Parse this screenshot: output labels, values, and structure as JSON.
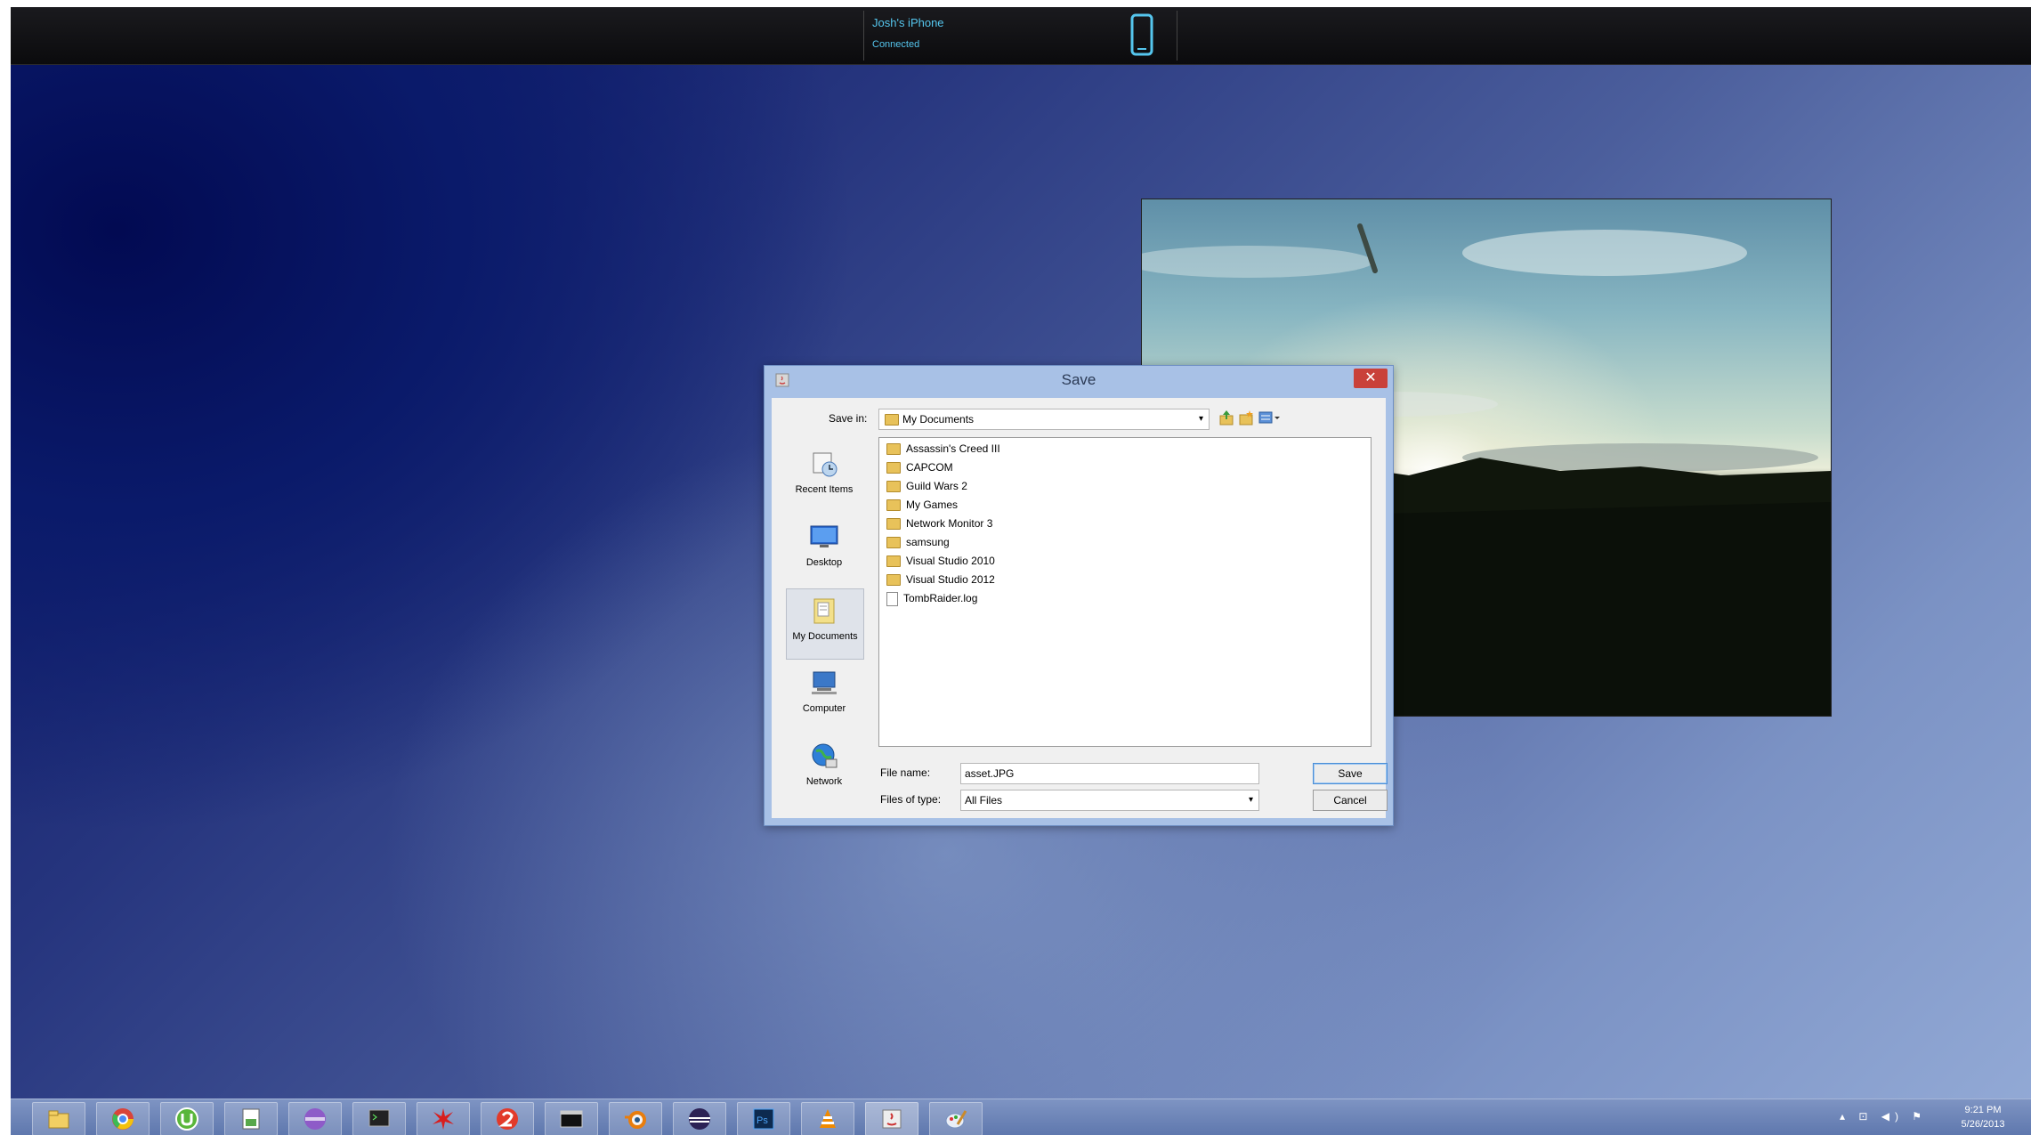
{
  "device_bar": {
    "device_name": "Josh's iPhone",
    "device_status": "Connected",
    "accent": "#55c6ee"
  },
  "dialog": {
    "title": "Save",
    "close_glyph": "✕",
    "save_in_label": "Save in:",
    "save_in_value": "My Documents",
    "places": [
      {
        "label": "Recent Items",
        "icon": "recent-items-icon"
      },
      {
        "label": "Desktop",
        "icon": "desktop-icon"
      },
      {
        "label": "My Documents",
        "icon": "my-documents-icon",
        "selected": true
      },
      {
        "label": "Computer",
        "icon": "computer-icon"
      },
      {
        "label": "Network",
        "icon": "network-icon"
      }
    ],
    "files": [
      {
        "name": "Assassin's Creed III",
        "type": "folder"
      },
      {
        "name": "CAPCOM",
        "type": "folder"
      },
      {
        "name": "Guild Wars 2",
        "type": "folder"
      },
      {
        "name": "My Games",
        "type": "folder"
      },
      {
        "name": "Network Monitor 3",
        "type": "folder"
      },
      {
        "name": "samsung",
        "type": "folder"
      },
      {
        "name": "Visual Studio 2010",
        "type": "folder"
      },
      {
        "name": "Visual Studio 2012",
        "type": "folder"
      },
      {
        "name": "TombRaider.log",
        "type": "file"
      }
    ],
    "file_name_label": "File name:",
    "file_name_value": "asset.JPG",
    "file_type_label": "Files of type:",
    "file_type_value": "All Files",
    "save_button": "Save",
    "cancel_button": "Cancel"
  },
  "taskbar": {
    "items": [
      "file-explorer-icon",
      "chrome-icon",
      "utorrent-icon",
      "notepad-icon",
      "media-player-icon",
      "console-icon",
      "red-app-icon",
      "app-2-icon",
      "terminal-icon",
      "blender-icon",
      "eclipse-icon",
      "photoshop-icon",
      "vlc-icon",
      "java-icon",
      "paint-icon"
    ],
    "active_index": 13,
    "tray_glyphs": "▴ ⊡ ◀) ⚑",
    "clock_time": "9:21 PM",
    "clock_date": "5/26/2013"
  }
}
